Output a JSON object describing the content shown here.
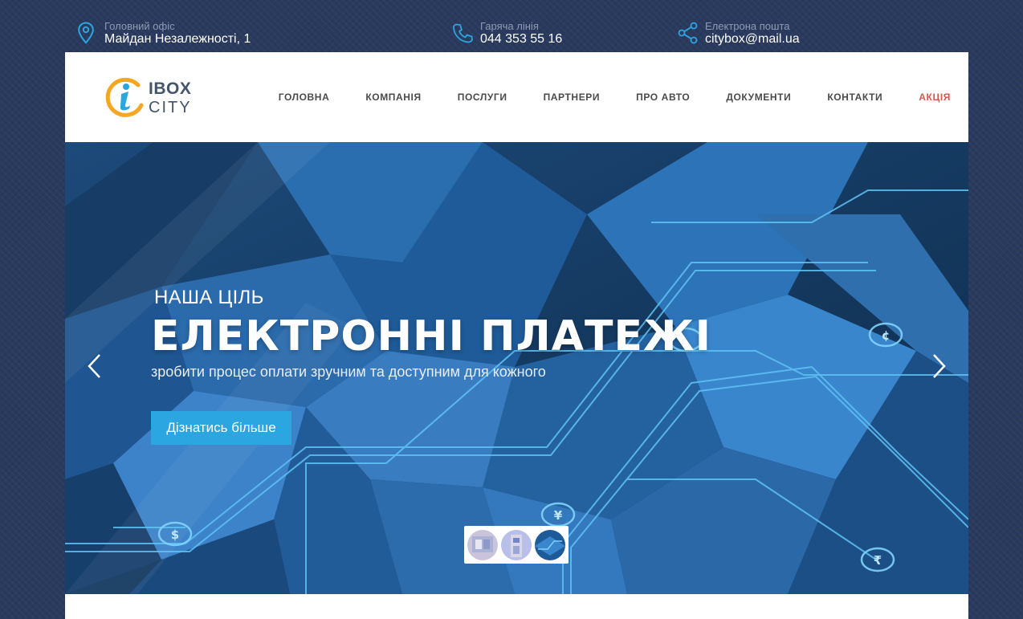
{
  "contacts": {
    "office": {
      "label": "Головний офіс",
      "value": "Майдан Незалежності, 1",
      "icon": "map-pin-icon"
    },
    "phone": {
      "label": "Гаряча лінія",
      "value": "044 353 55 16",
      "icon": "phone-icon"
    },
    "email": {
      "label": "Електрона пошта",
      "value": "citybox@mail.ua",
      "icon": "share-icon"
    }
  },
  "logo": {
    "line1": "IBOX",
    "line2": "CITY",
    "accent": "#f5a623",
    "mark_color": "#2ba6e0"
  },
  "nav": {
    "items": [
      {
        "label": "ГОЛОВНА"
      },
      {
        "label": "КОМПАНІЯ"
      },
      {
        "label": "ПОСЛУГИ"
      },
      {
        "label": "ПАРТНЕРИ"
      },
      {
        "label": "ПРО АВТО"
      },
      {
        "label": "ДОКУМЕНТИ"
      },
      {
        "label": "КОНТАКТИ"
      },
      {
        "label": "АКЦІЯ",
        "color": "#d9534f"
      }
    ]
  },
  "hero": {
    "subtitle": "НАША ЦІЛЬ",
    "title": "ЕЛЕКТРОННІ ПЛАТЕЖІ",
    "description": "зробити процес оплати зручним та доступним для кожного",
    "button_label": "Дізнатись більше",
    "button_color": "#2ba6e0",
    "currency_symbols": [
      "¢",
      "$",
      "¥",
      "₹"
    ],
    "prev_icon": "chevron-left-icon",
    "next_icon": "chevron-right-icon",
    "thumbnails": [
      "slide-1-thumbnail",
      "slide-2-thumbnail",
      "slide-3-thumbnail"
    ]
  },
  "colors": {
    "page_bg": "#2a3a5e",
    "accent_blue": "#2ba6e0",
    "promo_red": "#d9534f"
  }
}
